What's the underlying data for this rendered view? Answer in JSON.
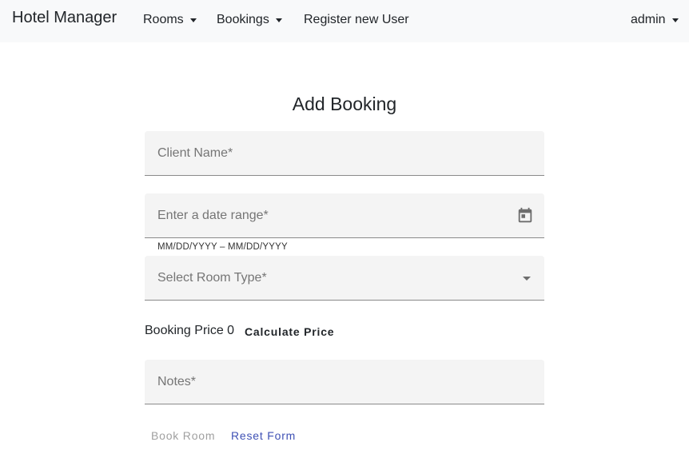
{
  "navbar": {
    "brand": "Hotel Manager",
    "rooms": "Rooms",
    "bookings": "Bookings",
    "register": "Register new User",
    "user": "admin"
  },
  "form": {
    "title": "Add Booking",
    "client_name_placeholder": "Client Name*",
    "date_range_placeholder": "Enter a date range*",
    "date_hint": "MM/DD/YYYY – MM/DD/YYYY",
    "room_type_placeholder": "Select Room Type*",
    "booking_price_label": "Booking Price",
    "booking_price_value": "0",
    "calculate_label": "Calculate Price",
    "notes_placeholder": "Notes*",
    "book_label": "Book Room",
    "reset_label": "Reset Form"
  },
  "icons": {
    "date_picker": "calendar-icon",
    "room_type_dropdown": "arrow-drop-down-icon"
  },
  "colors": {
    "accent": "#3f51b5",
    "disabled": "#a0a0a0",
    "field_bg": "#f4f4f4"
  }
}
